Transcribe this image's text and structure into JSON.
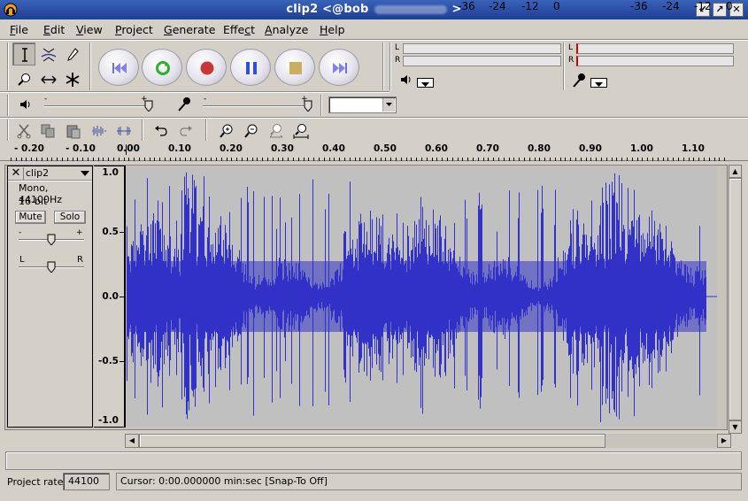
{
  "window": {
    "title_left": "clip2 <@bob",
    "title_right": ">",
    "colors": {
      "titlebar": "#2a4fa8",
      "waveform": "#3232c8",
      "wave_bg": "#c0c0c0",
      "meter_red": "#cc0000"
    }
  },
  "menu": [
    {
      "label": "File",
      "underline": "F",
      "rest": "ile"
    },
    {
      "label": "Edit",
      "underline": "E",
      "rest": "dit"
    },
    {
      "label": "View",
      "underline": "V",
      "rest": "iew"
    },
    {
      "label": "Project",
      "underline": "P",
      "rest": "roject"
    },
    {
      "label": "Generate",
      "underline": "G",
      "rest": "enerate"
    },
    {
      "label": "Effect",
      "underline": "",
      "pre": "Effe",
      "u": "c",
      "post": "t"
    },
    {
      "label": "Analyze",
      "underline": "A",
      "rest": "nalyze"
    },
    {
      "label": "Help",
      "underline": "H",
      "rest": "elp"
    }
  ],
  "tools": [
    "selection-tool-icon",
    "envelope-tool-icon",
    "draw-tool-icon",
    "zoom-tool-icon",
    "timeshift-tool-icon",
    "multi-tool-icon"
  ],
  "transport": [
    "skip-start-icon",
    "play-icon",
    "record-icon",
    "pause-icon",
    "stop-icon",
    "skip-end-icon"
  ],
  "meters": {
    "left_label": "L",
    "right_label": "R",
    "ticks": [
      "-36",
      "-24",
      "-12",
      "0"
    ]
  },
  "ruler": {
    "labels": [
      "- 0.20",
      "- 0.10",
      "0.00",
      "0.10",
      "0.20",
      "0.30",
      "0.40",
      "0.50",
      "0.60",
      "0.70",
      "0.80",
      "0.90",
      "1.00",
      "1.10"
    ]
  },
  "track": {
    "name": "clip2",
    "format": "Mono, 44100Hz",
    "bits": "16-bit",
    "mute_label": "Mute",
    "solo_label": "Solo",
    "gain_minus": "-",
    "gain_plus": "+",
    "pan_left": "L",
    "pan_right": "R",
    "amplitude_labels": [
      "1.0",
      "0.5",
      "0.0",
      "-0.5",
      "-1.0"
    ]
  },
  "status": {
    "project_rate_label": "Project rate:",
    "project_rate_value": "44100",
    "cursor_text": "Cursor: 0:00.000000 min:sec   [Snap-To Off]"
  }
}
